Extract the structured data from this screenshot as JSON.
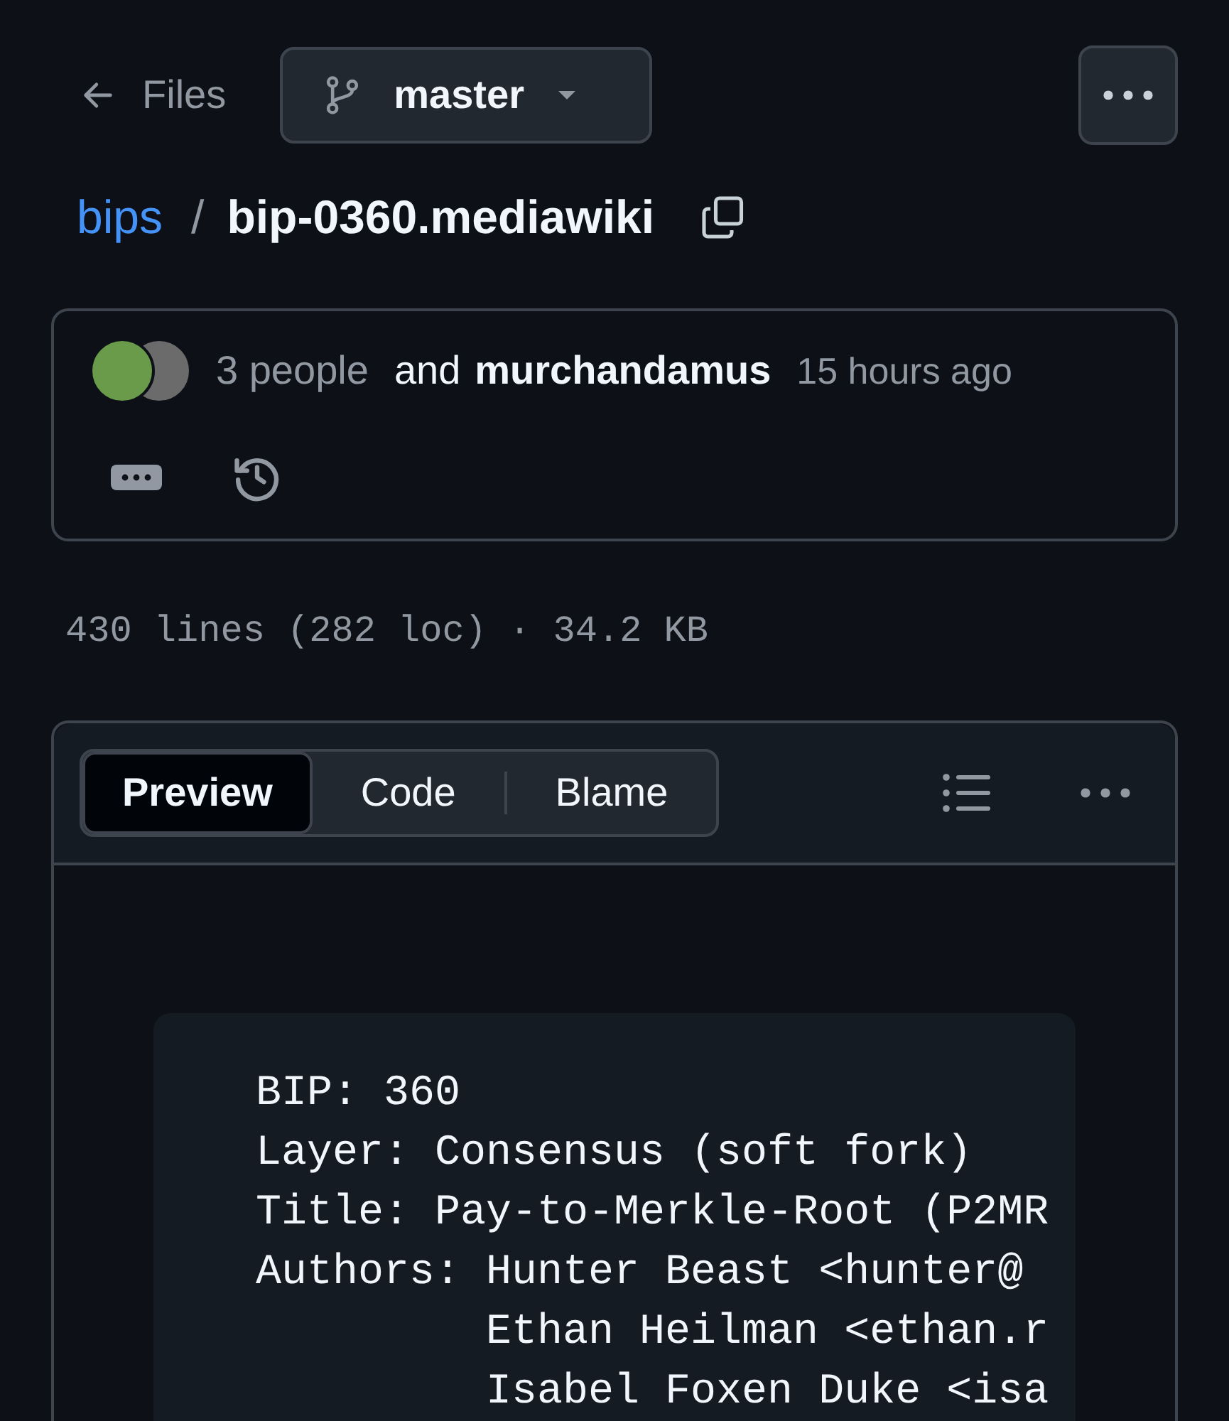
{
  "nav": {
    "back_label": "Files",
    "branch": "master"
  },
  "breadcrumb": {
    "repo": "bips",
    "separator": "/",
    "file": "bip-0360.mediawiki"
  },
  "commit": {
    "people": "3 people",
    "and": "and",
    "author": "murchandamus",
    "time": "15 hours ago"
  },
  "file_info": "430 lines (282 loc) · 34.2 KB",
  "tabs": [
    {
      "label": "Preview",
      "selected": true
    },
    {
      "label": "Code",
      "selected": false
    },
    {
      "label": "Blame",
      "selected": false
    }
  ],
  "code_lines": [
    "BIP: 360",
    "Layer: Consensus (soft fork)",
    "Title: Pay-to-Merkle-Root (P2MR",
    "Authors: Hunter Beast <hunter@",
    "         Ethan Heilman <ethan.r",
    "         Isabel Foxen Duke <isa"
  ]
}
